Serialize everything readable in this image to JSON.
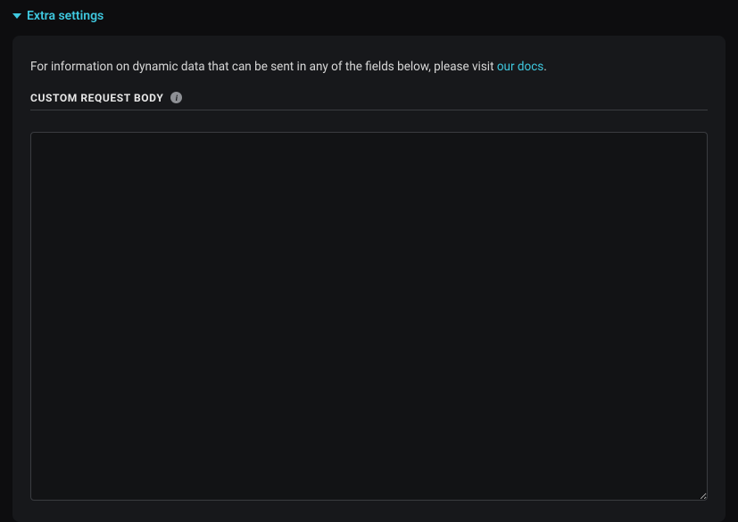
{
  "section": {
    "title": "Extra settings"
  },
  "info": {
    "prefix": "For information on dynamic data that can be sent in any of the fields below, please visit ",
    "link_text": "our docs",
    "suffix": "."
  },
  "field": {
    "label": "CUSTOM REQUEST BODY",
    "info_glyph": "i",
    "value": ""
  },
  "colors": {
    "accent": "#3fc9e0",
    "panel_bg": "#17181b",
    "page_bg": "#0d0d0f",
    "border": "#3a3c40"
  }
}
